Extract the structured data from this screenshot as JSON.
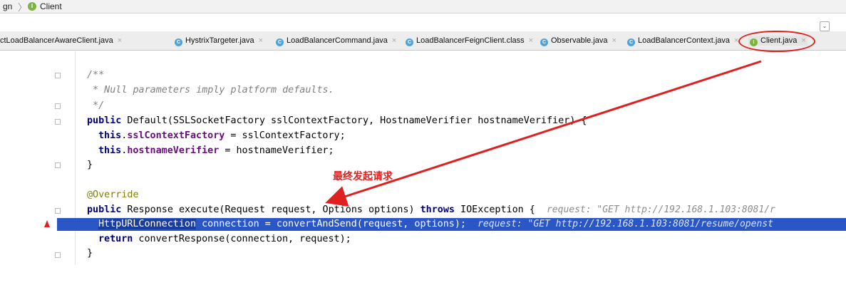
{
  "breadcrumb": {
    "segment": "gn",
    "icon_letter": "I",
    "current": "Client"
  },
  "tabs": [
    {
      "label": "ctLoadBalancerAwareClient.java",
      "icon": "",
      "left": 0
    },
    {
      "label": "HystrixTargeter.java",
      "icon": "C"
    },
    {
      "label": "LoadBalancerCommand.java",
      "icon": "C"
    },
    {
      "label": "LoadBalancerFeignClient.class",
      "icon": "C"
    },
    {
      "label": "Observable.java",
      "icon": "C"
    },
    {
      "label": "LoadBalancerContext.java",
      "icon": "C"
    },
    {
      "label": "Client.java",
      "icon": "I"
    }
  ],
  "code": {
    "l1": "/**",
    "l2": " * Null parameters imply platform defaults.",
    "l3": " */",
    "l4_kw": "public",
    "l4_rest": " Default(SSLSocketFactory sslContextFactory, HostnameVerifier hostnameVerifier) {",
    "l5_kw": "this",
    "l5_fld": "sslContextFactory",
    "l5_rest": " = sslContextFactory;",
    "l6_kw": "this",
    "l6_fld": "hostnameVerifier",
    "l6_rest": " = hostnameVerifier;",
    "l7": "}",
    "l8": "@Override",
    "l9_kw": "public",
    "l9_mid": " Response execute(Request request, Options options) ",
    "l9_kw2": "throws",
    "l9_rest": " IOException {",
    "l9_hint": "request: \"GET http://192.168.1.103:8081/r",
    "l10_sel": "HttpURLConnection",
    "l10_rest": " connection = convertAndSend(request, options);",
    "l10_hint": "request: \"GET http://192.168.1.103:8081/resume/openst",
    "l11_kw": "return",
    "l11_rest": " convertResponse(connection, request);",
    "l12": "}"
  },
  "annotation": {
    "text": "最终发起请求",
    "color": "#e0201e"
  },
  "colors": {
    "highlight": "#2a56c6",
    "arrow": "#e0201e"
  }
}
